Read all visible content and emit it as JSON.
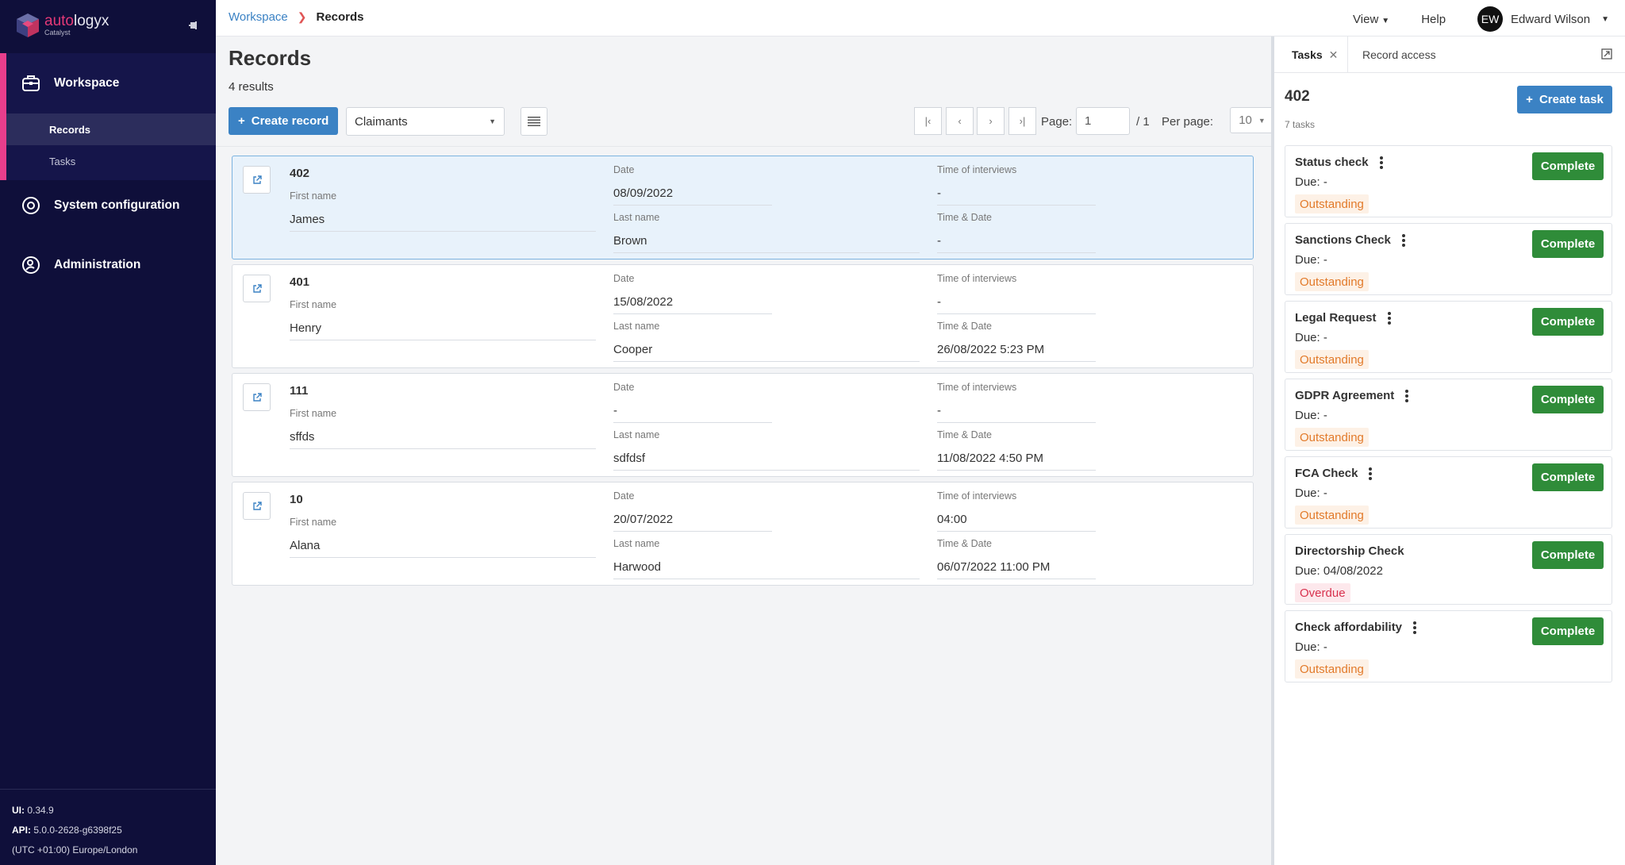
{
  "brand": {
    "name_auto": "auto",
    "name_rest": "logyx",
    "sub": "Catalyst"
  },
  "sidebar": {
    "workspace": {
      "label": "Workspace",
      "items": [
        {
          "label": "Records"
        },
        {
          "label": "Tasks"
        }
      ]
    },
    "system_configuration": "System configuration",
    "administration": "Administration",
    "footer": {
      "ui_label": "UI:",
      "ui_version": "0.34.9",
      "api_label": "API:",
      "api_version": "5.0.0-2628-g6398f25",
      "timezone": "(UTC +01:00) Europe/London"
    }
  },
  "topbar": {
    "breadcrumb": {
      "parent": "Workspace",
      "current": "Records"
    },
    "view": "View",
    "help": "Help",
    "user": {
      "initials": "EW",
      "name": "Edward Wilson"
    }
  },
  "main": {
    "title": "Records",
    "result_count": "4 results",
    "create_label": "Create record",
    "filter": "Claimants",
    "page_label": "Page:",
    "page_value": "1",
    "page_total": "/ 1",
    "per_page_label": "Per page:",
    "per_page_value": "10"
  },
  "labels": {
    "first_name": "First name",
    "last_name": "Last name",
    "date": "Date",
    "time_of_interviews": "Time of interviews",
    "time_date": "Time & Date"
  },
  "records": [
    {
      "id": "402",
      "first_name": "James",
      "last_name": "Brown",
      "date": "08/09/2022",
      "time_of_interviews": "-",
      "time_date": "-"
    },
    {
      "id": "401",
      "first_name": "Henry",
      "last_name": "Cooper",
      "date": "15/08/2022",
      "time_of_interviews": "-",
      "time_date": "26/08/2022 5:23 PM"
    },
    {
      "id": "111",
      "first_name": "sffds",
      "last_name": "sdfdsf",
      "date": "-",
      "time_of_interviews": "-",
      "time_date": "11/08/2022 4:50 PM"
    },
    {
      "id": "10",
      "first_name": "Alana",
      "last_name": "Harwood",
      "date": "20/07/2022",
      "time_of_interviews": "04:00",
      "time_date": "06/07/2022 11:00 PM"
    }
  ],
  "panel": {
    "tab_tasks": "Tasks",
    "tab_access": "Record access",
    "title": "402",
    "count": "7 tasks",
    "create_label": "Create task",
    "complete_label": "Complete",
    "tasks": [
      {
        "name": "Status check",
        "due": "Due: -",
        "status": "Outstanding"
      },
      {
        "name": "Sanctions Check",
        "due": "Due: -",
        "status": "Outstanding"
      },
      {
        "name": "Legal Request",
        "due": "Due: -",
        "status": "Outstanding"
      },
      {
        "name": "GDPR Agreement",
        "due": "Due: -",
        "status": "Outstanding"
      },
      {
        "name": "FCA Check",
        "due": "Due: -",
        "status": "Outstanding"
      },
      {
        "name": "Directorship Check",
        "due": "Due: 04/08/2022",
        "status": "Overdue"
      },
      {
        "name": "Check affordability",
        "due": "Due: -",
        "status": "Outstanding"
      }
    ]
  },
  "colors": {
    "sidebar_bg": "#0f0f3a",
    "accent": "#e83e8c",
    "primary": "#3b82c4",
    "complete": "#2f8c39",
    "outstanding": "#e27a2a",
    "overdue": "#d8314e"
  }
}
